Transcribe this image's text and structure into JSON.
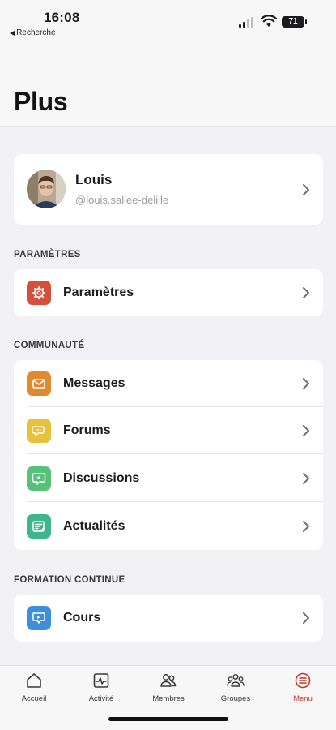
{
  "status_bar": {
    "time": "16:08",
    "back_label": "Recherche",
    "battery": "71"
  },
  "page": {
    "title": "Plus"
  },
  "profile": {
    "name": "Louis",
    "handle": "@louis.sallee-delille"
  },
  "sections": [
    {
      "title": "PARAMÈTRES",
      "items": [
        {
          "label": "Paramètres",
          "icon": "gear-icon",
          "color": "#d4503a"
        }
      ]
    },
    {
      "title": "COMMUNAUTÉ",
      "items": [
        {
          "label": "Messages",
          "icon": "envelope-icon",
          "color": "#e08a2e"
        },
        {
          "label": "Forums",
          "icon": "chat-bubbles-icon",
          "color": "#e7c13a"
        },
        {
          "label": "Discussions",
          "icon": "discussion-icon",
          "color": "#58c07a"
        },
        {
          "label": "Actualités",
          "icon": "news-icon",
          "color": "#3fb58e"
        }
      ]
    },
    {
      "title": "FORMATION CONTINUE",
      "items": [
        {
          "label": "Cours",
          "icon": "course-icon",
          "color": "#3d8fd9"
        }
      ]
    }
  ],
  "tabbar": [
    {
      "label": "Accueil",
      "icon": "home-icon"
    },
    {
      "label": "Activité",
      "icon": "activity-icon"
    },
    {
      "label": "Membres",
      "icon": "members-icon"
    },
    {
      "label": "Groupes",
      "icon": "groups-icon"
    },
    {
      "label": "Menu",
      "icon": "menu-icon",
      "active": true,
      "active_color": "#c0392b"
    }
  ]
}
